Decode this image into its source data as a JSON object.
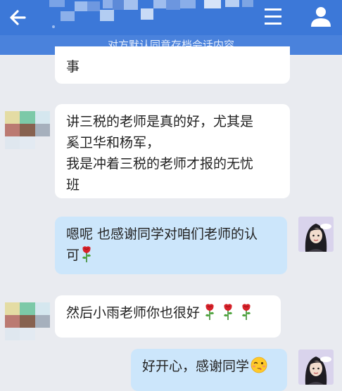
{
  "header": {
    "back_icon": "arrow-left-icon",
    "menu_icon": "hamburger-menu-icon",
    "profile_icon": "user-icon",
    "notice": "对方默认同意存档会话内容"
  },
  "messages": [
    {
      "side": "in",
      "lines": [
        "事"
      ]
    },
    {
      "side": "in",
      "lines": [
        "讲三税的老师是真的好，尤其是",
        "奚卫华和杨军，",
        "我是冲着三税的老师才报的无忧",
        "班"
      ]
    },
    {
      "side": "out",
      "lines": [
        "嗯呢 也感谢同学对咱们老师的认",
        "可"
      ]
    },
    {
      "side": "in",
      "lines": [
        "然后小雨老师你也很好"
      ]
    },
    {
      "side": "out",
      "lines": [
        "好开心，感谢同学"
      ]
    }
  ],
  "colors": {
    "header_bg": "#3c78d8",
    "notice_bg": "#4a82dc",
    "chat_bg": "#e9ebf0",
    "incoming_bubble": "#ffffff",
    "outgoing_bubble": "#cce6fb"
  },
  "emoji": [
    "rose-emoji",
    "wink-emoji"
  ]
}
